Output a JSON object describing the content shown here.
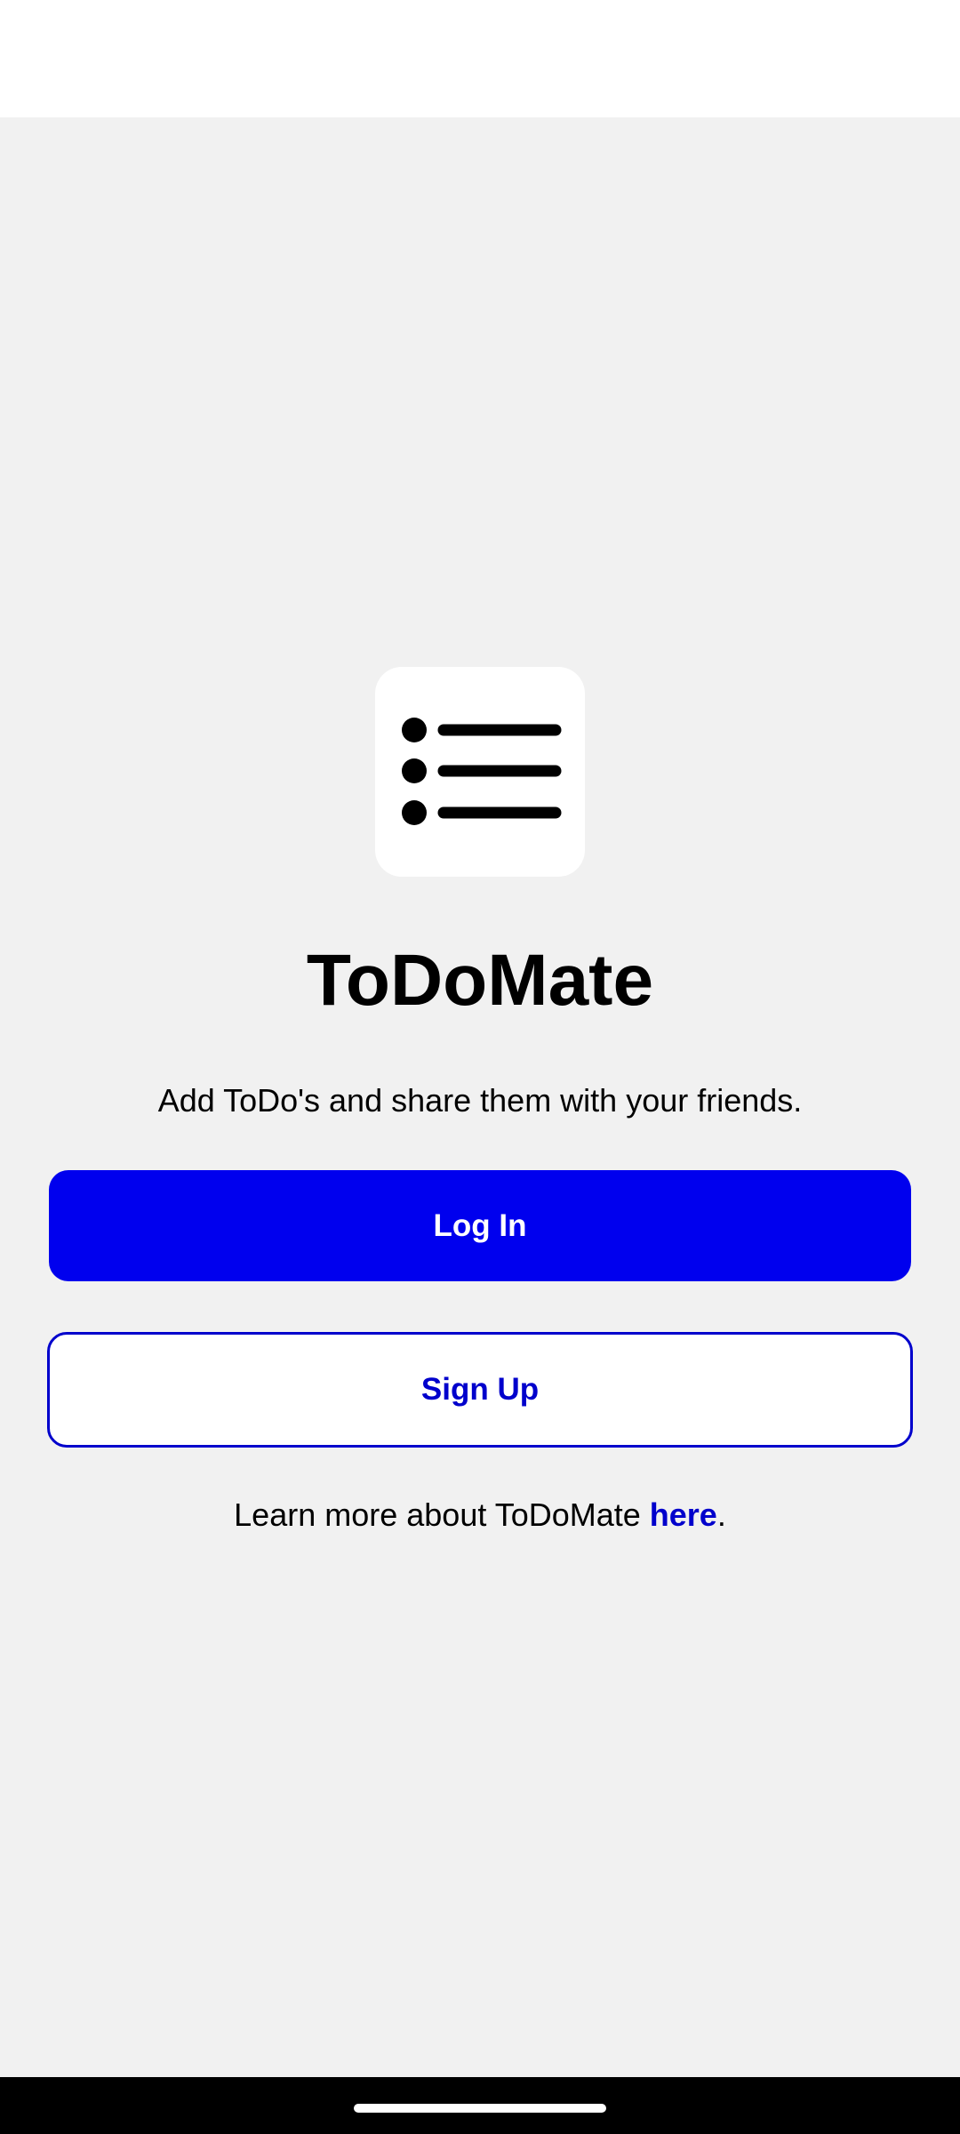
{
  "app": {
    "title": "ToDoMate",
    "tagline": "Add ToDo's and share them with your friends.",
    "icon": "list-icon"
  },
  "actions": {
    "login_label": "Log In",
    "signup_label": "Sign Up"
  },
  "learn_more": {
    "prefix": "Learn more about ToDoMate ",
    "link_text": "here",
    "suffix": "."
  },
  "colors": {
    "primary": "#0000ee",
    "link": "#0000cc",
    "background": "#f1f1f1"
  }
}
